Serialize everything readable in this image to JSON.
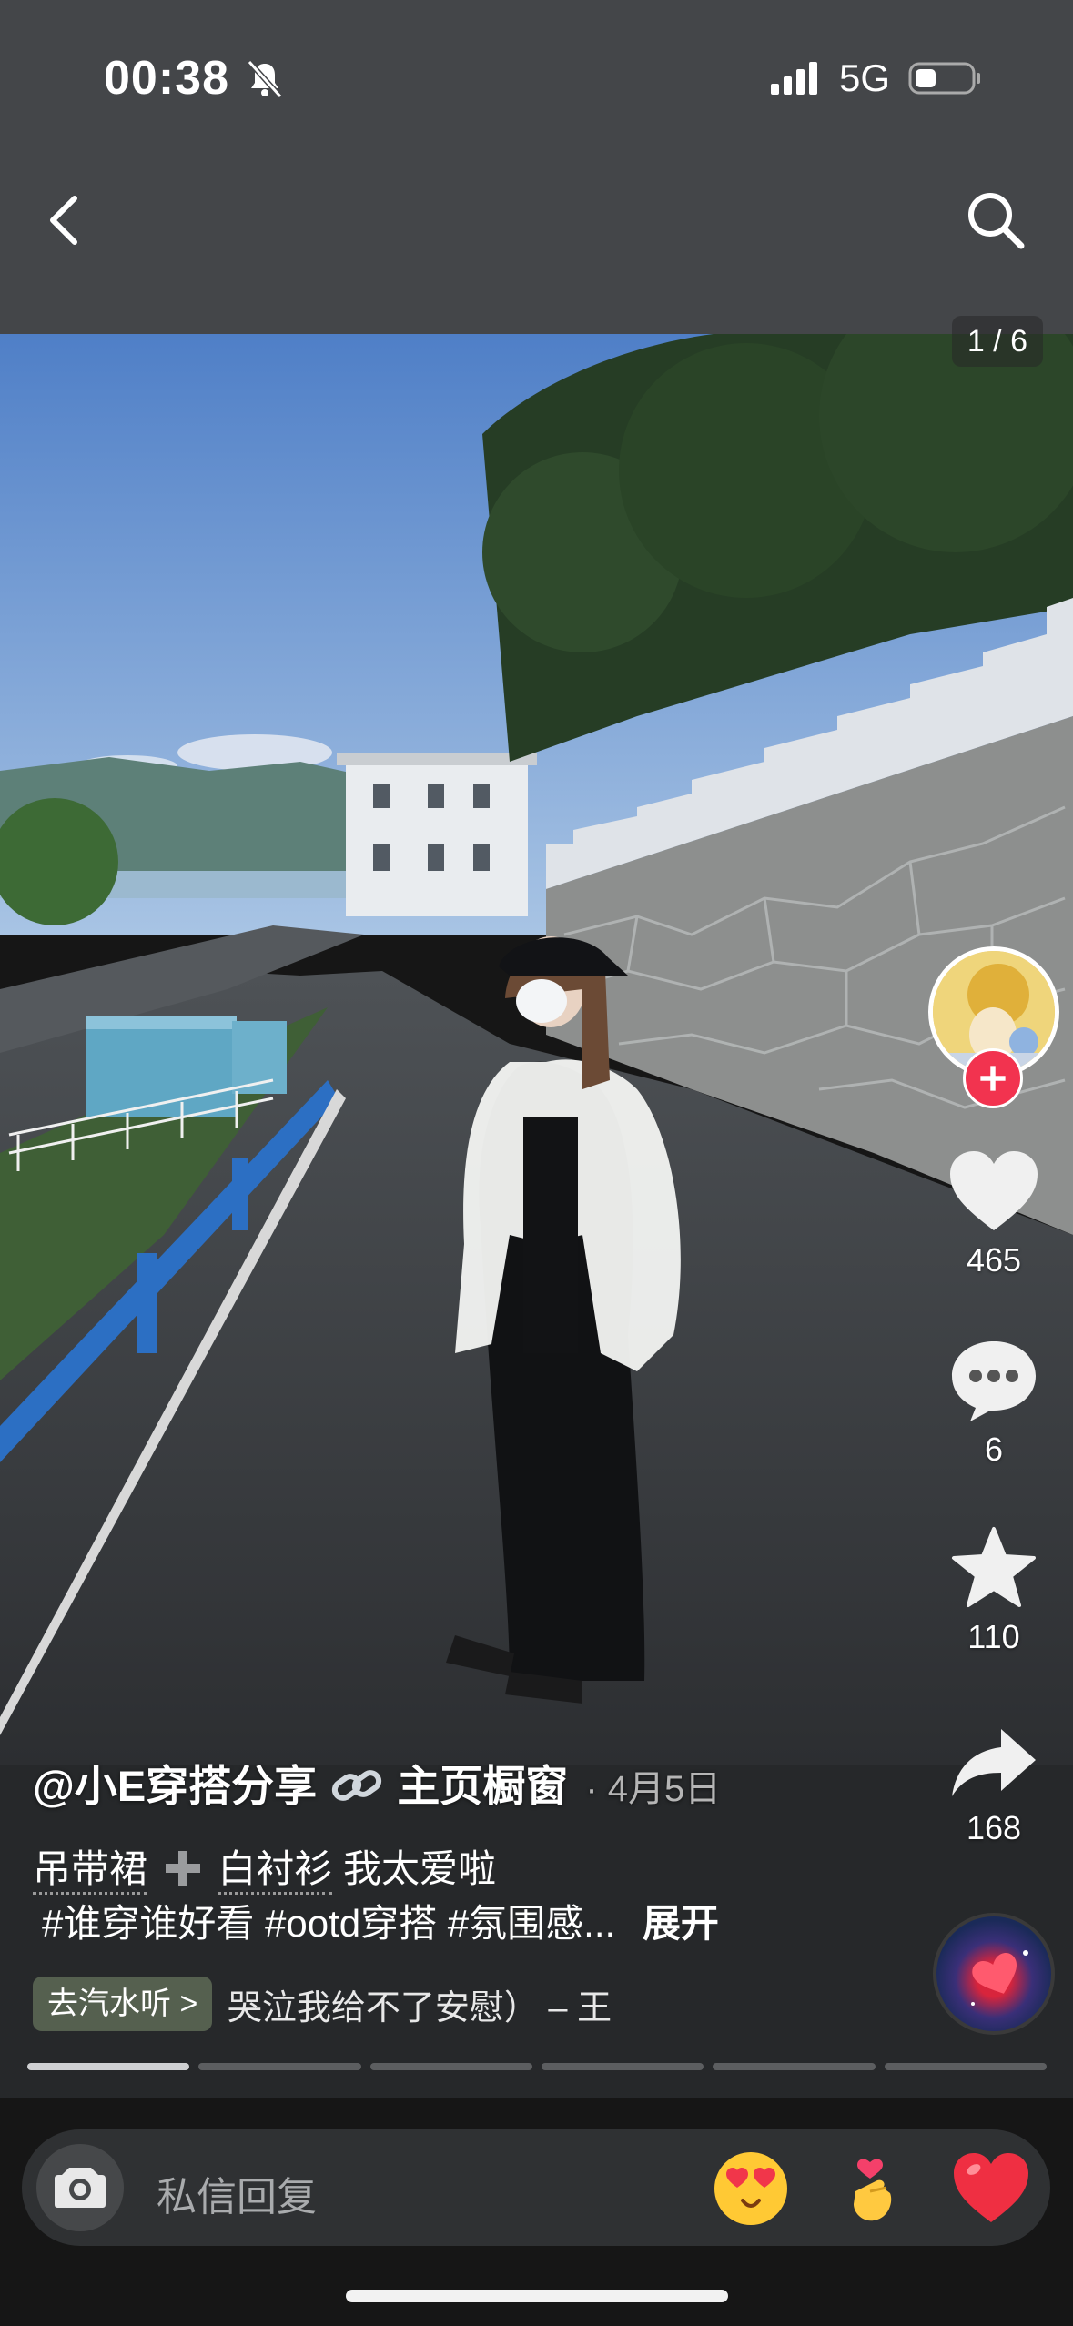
{
  "status_bar": {
    "time": "00:38",
    "network": "5G"
  },
  "photo": {
    "page_counter": "1 / 6",
    "page_index": 1,
    "page_total": 6
  },
  "post": {
    "author": "@小E穿搭分享",
    "author_suffix": "主页橱窗",
    "date": "· 4月5日",
    "caption_part1": "吊带裙",
    "caption_part2": "白衬衫",
    "caption_part3": "我太爱啦",
    "hashtags": "#谁穿谁好看 #ootd穿搭 #氛围感...",
    "expand_label": "展开"
  },
  "music": {
    "chip_label": "去汽水听 >",
    "title": "哭泣我给不了安慰） – 王"
  },
  "actions": {
    "likes": "465",
    "comments": "6",
    "favorites": "110",
    "shares": "168"
  },
  "reply": {
    "placeholder": "私信回复"
  },
  "icons": {
    "back": "chevron-left-icon",
    "search": "search-icon",
    "like": "heart-icon",
    "comment": "comment-bubble-icon",
    "favorite": "star-icon",
    "share": "share-arrow-icon",
    "camera": "camera-icon",
    "follow": "plus-icon"
  },
  "colors": {
    "follow_red": "#f2334f",
    "music_chip": "#55604f"
  }
}
